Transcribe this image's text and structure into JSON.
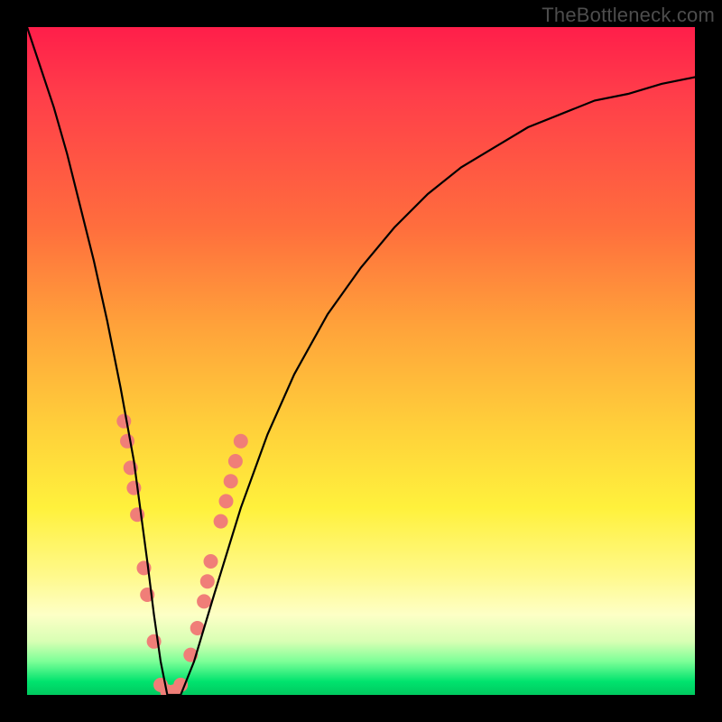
{
  "watermark": "TheBottleneck.com",
  "chart_data": {
    "type": "line",
    "title": "",
    "xlabel": "",
    "ylabel": "",
    "xlim": [
      0,
      100
    ],
    "ylim": [
      0,
      100
    ],
    "series": [
      {
        "name": "bottleneck-curve",
        "x": [
          0,
          2,
          4,
          6,
          8,
          10,
          12,
          14,
          16,
          18,
          19,
          20,
          21,
          22,
          23,
          25,
          28,
          32,
          36,
          40,
          45,
          50,
          55,
          60,
          65,
          70,
          75,
          80,
          85,
          90,
          95,
          100
        ],
        "y": [
          100,
          94,
          88,
          81,
          73,
          65,
          56,
          46,
          35,
          20,
          12,
          5,
          0,
          0,
          0,
          5,
          15,
          28,
          39,
          48,
          57,
          64,
          70,
          75,
          79,
          82,
          85,
          87,
          89,
          90,
          91.5,
          92.5
        ]
      }
    ],
    "markers": {
      "name": "highlight-dots",
      "color": "#f07e78",
      "points": [
        {
          "x": 14.5,
          "y": 41
        },
        {
          "x": 15.0,
          "y": 38
        },
        {
          "x": 15.5,
          "y": 34
        },
        {
          "x": 16.0,
          "y": 31
        },
        {
          "x": 16.5,
          "y": 27
        },
        {
          "x": 17.5,
          "y": 19
        },
        {
          "x": 18.0,
          "y": 15
        },
        {
          "x": 19.0,
          "y": 8
        },
        {
          "x": 20.0,
          "y": 1.5
        },
        {
          "x": 21.0,
          "y": 0.5
        },
        {
          "x": 22.0,
          "y": 0.5
        },
        {
          "x": 23.0,
          "y": 1.5
        },
        {
          "x": 24.5,
          "y": 6
        },
        {
          "x": 25.5,
          "y": 10
        },
        {
          "x": 26.5,
          "y": 14
        },
        {
          "x": 27.0,
          "y": 17
        },
        {
          "x": 27.5,
          "y": 20
        },
        {
          "x": 29.0,
          "y": 26
        },
        {
          "x": 29.8,
          "y": 29
        },
        {
          "x": 30.5,
          "y": 32
        },
        {
          "x": 31.2,
          "y": 35
        },
        {
          "x": 32.0,
          "y": 38
        }
      ]
    }
  }
}
